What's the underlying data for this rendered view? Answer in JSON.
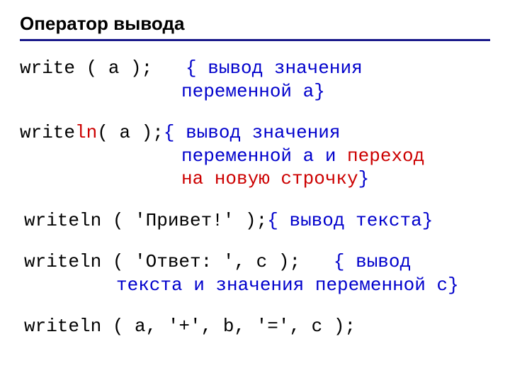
{
  "title": "Оператор вывода",
  "line1": {
    "code": "write ( a );",
    "gap": "   ",
    "c1": "{ вывод значения",
    "c2": "переменной a}"
  },
  "line2": {
    "p1": "write",
    "ln": "ln",
    "p2": " ( a ); ",
    "c1": "{ вывод значения",
    "c2a": "переменной a и ",
    "c2b": "переход",
    "c3a": "на новую строчку",
    "c3b": "}"
  },
  "line3": {
    "code": "writeln ( 'Привет!' ); ",
    "c": "{ вывод текста}"
  },
  "line4": {
    "code": "writeln ( 'Ответ: ', c );",
    "gap": "   ",
    "c1": "{ вывод",
    "c2": "текста и значения переменной c}"
  },
  "line5": {
    "code": "writeln ( a, '+', b, '=', c );"
  }
}
